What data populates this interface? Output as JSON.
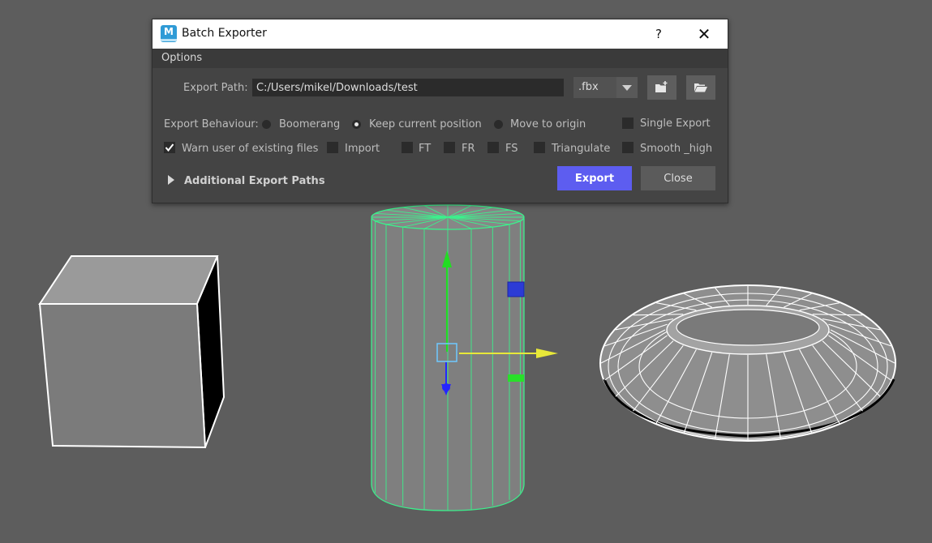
{
  "dialog": {
    "title": "Batch Exporter",
    "app_icon": "maya-icon",
    "help_label": "?",
    "close_label": "✕",
    "menu": [
      "Options"
    ],
    "export_path": {
      "label": "Export Path:",
      "value": "C:/Users/mikel/Downloads/test"
    },
    "format_select": {
      "value": ".fbx"
    },
    "icon_buttons": [
      "new-folder-icon",
      "open-folder-icon"
    ],
    "export_behaviour": {
      "label": "Export Behaviour:",
      "options": [
        {
          "label": "Boomerang",
          "selected": false
        },
        {
          "label": "Keep current position",
          "selected": true
        },
        {
          "label": "Move to origin",
          "selected": false
        }
      ]
    },
    "checkboxes": [
      {
        "label": "Single Export",
        "checked": false
      },
      {
        "label": "Warn user of existing files",
        "checked": true
      },
      {
        "label": "Import",
        "checked": false
      },
      {
        "label": "FT",
        "checked": false
      },
      {
        "label": "FR",
        "checked": false
      },
      {
        "label": "FS",
        "checked": false
      },
      {
        "label": "Triangulate",
        "checked": false
      },
      {
        "label": "Smooth _high",
        "checked": false
      }
    ],
    "additional_paths_label": "Additional Export Paths",
    "export_button": "Export",
    "close_button": "Close"
  },
  "colors": {
    "accent": "#5d5df0",
    "selection_wire": "#3cf08c",
    "viewport_bg": "#5d5d5d"
  }
}
